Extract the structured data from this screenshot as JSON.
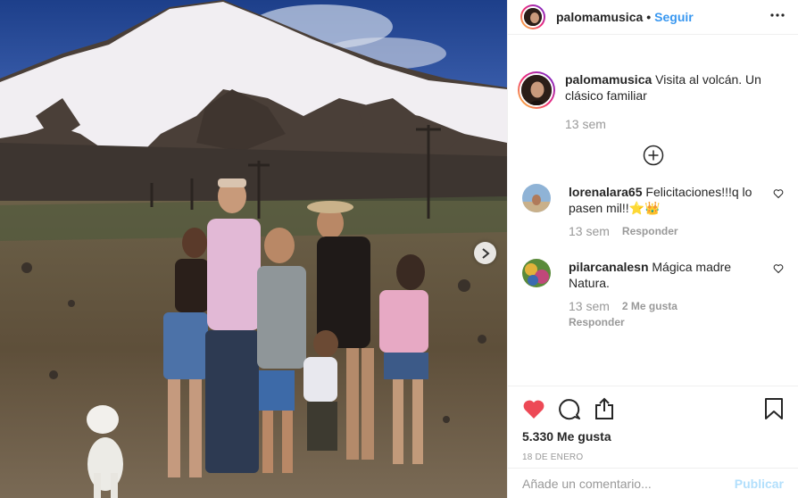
{
  "post": {
    "username": "palomamusica",
    "follow_label": "Seguir",
    "separator": "•",
    "caption": "Visita al volcán. Un clásico familiar",
    "caption_time": "13 sem",
    "likes": "5.330 Me gusta",
    "date": "18 DE ENERO"
  },
  "comments": [
    {
      "user": "lorenalara65",
      "text": "Felicitaciones!!!q lo pasen mil!!⭐👑",
      "time": "13 sem",
      "likes": "",
      "reply": "Responder"
    },
    {
      "user": "pilarcanalesn",
      "text": "Mágica madre Natura.",
      "time": "13 sem",
      "likes": "2 Me gusta",
      "reply": "Responder"
    }
  ],
  "add_comment": {
    "placeholder": "Añade un comentario...",
    "publish_label": "Publicar"
  },
  "icons": {
    "more": "more-dots-icon",
    "load_more": "plus-circle-icon",
    "like": "heart-filled-icon",
    "comment": "comment-bubble-icon",
    "share": "share-icon",
    "save": "bookmark-icon",
    "next": "chevron-right-icon"
  },
  "colors": {
    "like_red": "#ed4956",
    "link_blue": "#3897f0",
    "publish_disabled": "#b2dffc"
  }
}
